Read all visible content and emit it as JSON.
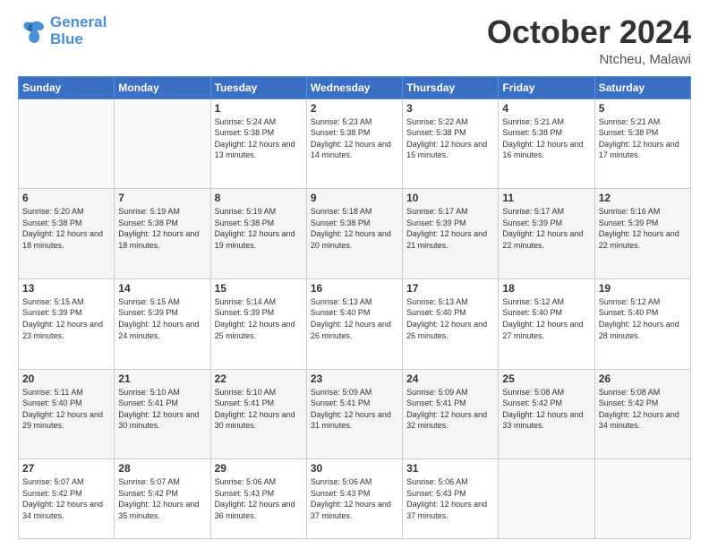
{
  "header": {
    "logo_line1": "General",
    "logo_line2": "Blue",
    "month_title": "October 2024",
    "location": "Ntcheu, Malawi"
  },
  "weekdays": [
    "Sunday",
    "Monday",
    "Tuesday",
    "Wednesday",
    "Thursday",
    "Friday",
    "Saturday"
  ],
  "weeks": [
    [
      {
        "day": "",
        "sunrise": "",
        "sunset": "",
        "daylight": ""
      },
      {
        "day": "",
        "sunrise": "",
        "sunset": "",
        "daylight": ""
      },
      {
        "day": "1",
        "sunrise": "Sunrise: 5:24 AM",
        "sunset": "Sunset: 5:38 PM",
        "daylight": "Daylight: 12 hours and 13 minutes."
      },
      {
        "day": "2",
        "sunrise": "Sunrise: 5:23 AM",
        "sunset": "Sunset: 5:38 PM",
        "daylight": "Daylight: 12 hours and 14 minutes."
      },
      {
        "day": "3",
        "sunrise": "Sunrise: 5:22 AM",
        "sunset": "Sunset: 5:38 PM",
        "daylight": "Daylight: 12 hours and 15 minutes."
      },
      {
        "day": "4",
        "sunrise": "Sunrise: 5:21 AM",
        "sunset": "Sunset: 5:38 PM",
        "daylight": "Daylight: 12 hours and 16 minutes."
      },
      {
        "day": "5",
        "sunrise": "Sunrise: 5:21 AM",
        "sunset": "Sunset: 5:38 PM",
        "daylight": "Daylight: 12 hours and 17 minutes."
      }
    ],
    [
      {
        "day": "6",
        "sunrise": "Sunrise: 5:20 AM",
        "sunset": "Sunset: 5:38 PM",
        "daylight": "Daylight: 12 hours and 18 minutes."
      },
      {
        "day": "7",
        "sunrise": "Sunrise: 5:19 AM",
        "sunset": "Sunset: 5:38 PM",
        "daylight": "Daylight: 12 hours and 18 minutes."
      },
      {
        "day": "8",
        "sunrise": "Sunrise: 5:19 AM",
        "sunset": "Sunset: 5:38 PM",
        "daylight": "Daylight: 12 hours and 19 minutes."
      },
      {
        "day": "9",
        "sunrise": "Sunrise: 5:18 AM",
        "sunset": "Sunset: 5:38 PM",
        "daylight": "Daylight: 12 hours and 20 minutes."
      },
      {
        "day": "10",
        "sunrise": "Sunrise: 5:17 AM",
        "sunset": "Sunset: 5:39 PM",
        "daylight": "Daylight: 12 hours and 21 minutes."
      },
      {
        "day": "11",
        "sunrise": "Sunrise: 5:17 AM",
        "sunset": "Sunset: 5:39 PM",
        "daylight": "Daylight: 12 hours and 22 minutes."
      },
      {
        "day": "12",
        "sunrise": "Sunrise: 5:16 AM",
        "sunset": "Sunset: 5:39 PM",
        "daylight": "Daylight: 12 hours and 22 minutes."
      }
    ],
    [
      {
        "day": "13",
        "sunrise": "Sunrise: 5:15 AM",
        "sunset": "Sunset: 5:39 PM",
        "daylight": "Daylight: 12 hours and 23 minutes."
      },
      {
        "day": "14",
        "sunrise": "Sunrise: 5:15 AM",
        "sunset": "Sunset: 5:39 PM",
        "daylight": "Daylight: 12 hours and 24 minutes."
      },
      {
        "day": "15",
        "sunrise": "Sunrise: 5:14 AM",
        "sunset": "Sunset: 5:39 PM",
        "daylight": "Daylight: 12 hours and 25 minutes."
      },
      {
        "day": "16",
        "sunrise": "Sunrise: 5:13 AM",
        "sunset": "Sunset: 5:40 PM",
        "daylight": "Daylight: 12 hours and 26 minutes."
      },
      {
        "day": "17",
        "sunrise": "Sunrise: 5:13 AM",
        "sunset": "Sunset: 5:40 PM",
        "daylight": "Daylight: 12 hours and 26 minutes."
      },
      {
        "day": "18",
        "sunrise": "Sunrise: 5:12 AM",
        "sunset": "Sunset: 5:40 PM",
        "daylight": "Daylight: 12 hours and 27 minutes."
      },
      {
        "day": "19",
        "sunrise": "Sunrise: 5:12 AM",
        "sunset": "Sunset: 5:40 PM",
        "daylight": "Daylight: 12 hours and 28 minutes."
      }
    ],
    [
      {
        "day": "20",
        "sunrise": "Sunrise: 5:11 AM",
        "sunset": "Sunset: 5:40 PM",
        "daylight": "Daylight: 12 hours and 29 minutes."
      },
      {
        "day": "21",
        "sunrise": "Sunrise: 5:10 AM",
        "sunset": "Sunset: 5:41 PM",
        "daylight": "Daylight: 12 hours and 30 minutes."
      },
      {
        "day": "22",
        "sunrise": "Sunrise: 5:10 AM",
        "sunset": "Sunset: 5:41 PM",
        "daylight": "Daylight: 12 hours and 30 minutes."
      },
      {
        "day": "23",
        "sunrise": "Sunrise: 5:09 AM",
        "sunset": "Sunset: 5:41 PM",
        "daylight": "Daylight: 12 hours and 31 minutes."
      },
      {
        "day": "24",
        "sunrise": "Sunrise: 5:09 AM",
        "sunset": "Sunset: 5:41 PM",
        "daylight": "Daylight: 12 hours and 32 minutes."
      },
      {
        "day": "25",
        "sunrise": "Sunrise: 5:08 AM",
        "sunset": "Sunset: 5:42 PM",
        "daylight": "Daylight: 12 hours and 33 minutes."
      },
      {
        "day": "26",
        "sunrise": "Sunrise: 5:08 AM",
        "sunset": "Sunset: 5:42 PM",
        "daylight": "Daylight: 12 hours and 34 minutes."
      }
    ],
    [
      {
        "day": "27",
        "sunrise": "Sunrise: 5:07 AM",
        "sunset": "Sunset: 5:42 PM",
        "daylight": "Daylight: 12 hours and 34 minutes."
      },
      {
        "day": "28",
        "sunrise": "Sunrise: 5:07 AM",
        "sunset": "Sunset: 5:42 PM",
        "daylight": "Daylight: 12 hours and 35 minutes."
      },
      {
        "day": "29",
        "sunrise": "Sunrise: 5:06 AM",
        "sunset": "Sunset: 5:43 PM",
        "daylight": "Daylight: 12 hours and 36 minutes."
      },
      {
        "day": "30",
        "sunrise": "Sunrise: 5:06 AM",
        "sunset": "Sunset: 5:43 PM",
        "daylight": "Daylight: 12 hours and 37 minutes."
      },
      {
        "day": "31",
        "sunrise": "Sunrise: 5:06 AM",
        "sunset": "Sunset: 5:43 PM",
        "daylight": "Daylight: 12 hours and 37 minutes."
      },
      {
        "day": "",
        "sunrise": "",
        "sunset": "",
        "daylight": ""
      },
      {
        "day": "",
        "sunrise": "",
        "sunset": "",
        "daylight": ""
      }
    ]
  ]
}
